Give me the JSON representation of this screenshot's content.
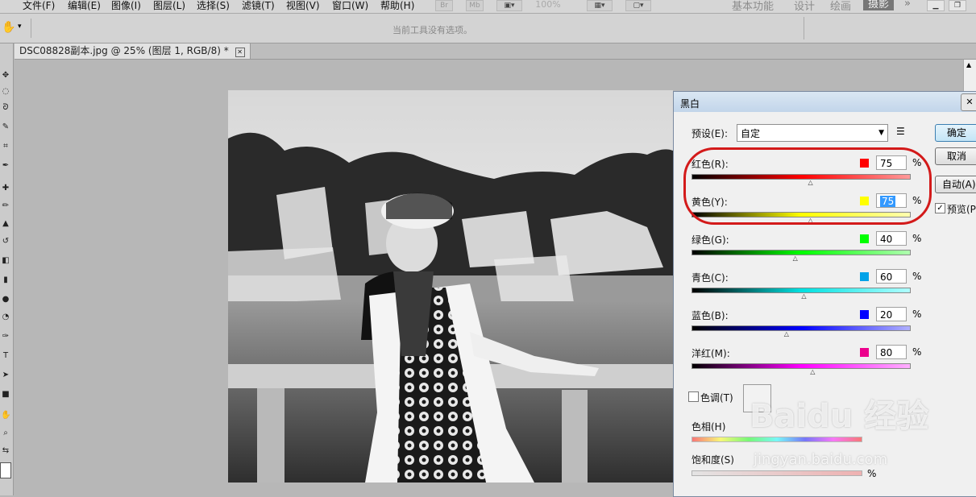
{
  "menubar": {
    "items": [
      "文件(F)",
      "编辑(E)",
      "图像(I)",
      "图层(L)",
      "选择(S)",
      "滤镜(T)",
      "视图(V)",
      "窗口(W)",
      "帮助(H)"
    ],
    "bridge": "Br",
    "minibridge": "Mb",
    "zoom": "100%",
    "workspaces": [
      "基本功能",
      "设计",
      "绘画",
      "摄影"
    ],
    "active_workspace": "摄影"
  },
  "options_bar": {
    "message": "当前工具没有选项。"
  },
  "document": {
    "tab_title": "DSC08828副本.jpg @ 25% (图层 1, RGB/8) *",
    "tab_close": "✕"
  },
  "dialog": {
    "title": "黑白",
    "close": "✕",
    "preset_label": "预设(E):",
    "preset_value": "自定",
    "buttons": {
      "ok": "确定",
      "cancel": "取消",
      "auto": "自动(A)"
    },
    "preview_label": "预览(P)",
    "preview_checked": true,
    "channels": [
      {
        "label": "红色(R):",
        "value": "75",
        "color": "#ff0000",
        "ramp": [
          "#000000",
          "#ff0000",
          "#ff9a9a"
        ]
      },
      {
        "label": "黄色(Y):",
        "value": "75",
        "color": "#ffff00",
        "ramp": [
          "#000000",
          "#ffff00",
          "#ffffb0"
        ],
        "selected": true
      },
      {
        "label": "绿色(G):",
        "value": "40",
        "color": "#00ff00",
        "ramp": [
          "#000000",
          "#00ff00",
          "#b0ffb0"
        ]
      },
      {
        "label": "青色(C):",
        "value": "60",
        "color": "#00a2e8",
        "ramp": [
          "#000000",
          "#00e0e0",
          "#b0ffff"
        ]
      },
      {
        "label": "蓝色(B):",
        "value": "20",
        "color": "#0000ff",
        "ramp": [
          "#000000",
          "#0000ff",
          "#b0b0ff"
        ]
      },
      {
        "label": "洋红(M):",
        "value": "80",
        "color": "#ec008c",
        "ramp": [
          "#000000",
          "#ff00ff",
          "#ffb0ff"
        ]
      }
    ],
    "percent": "%",
    "tint_label": "色调(T)",
    "tint_checked": false,
    "hue_label": "色相(H)",
    "saturation_label": "饱和度(S)"
  },
  "watermark": {
    "logo_text": "Baidu 经验",
    "url": "jingyan.baidu.com"
  },
  "colors": {
    "annotation_circle": "#d31a1a"
  }
}
